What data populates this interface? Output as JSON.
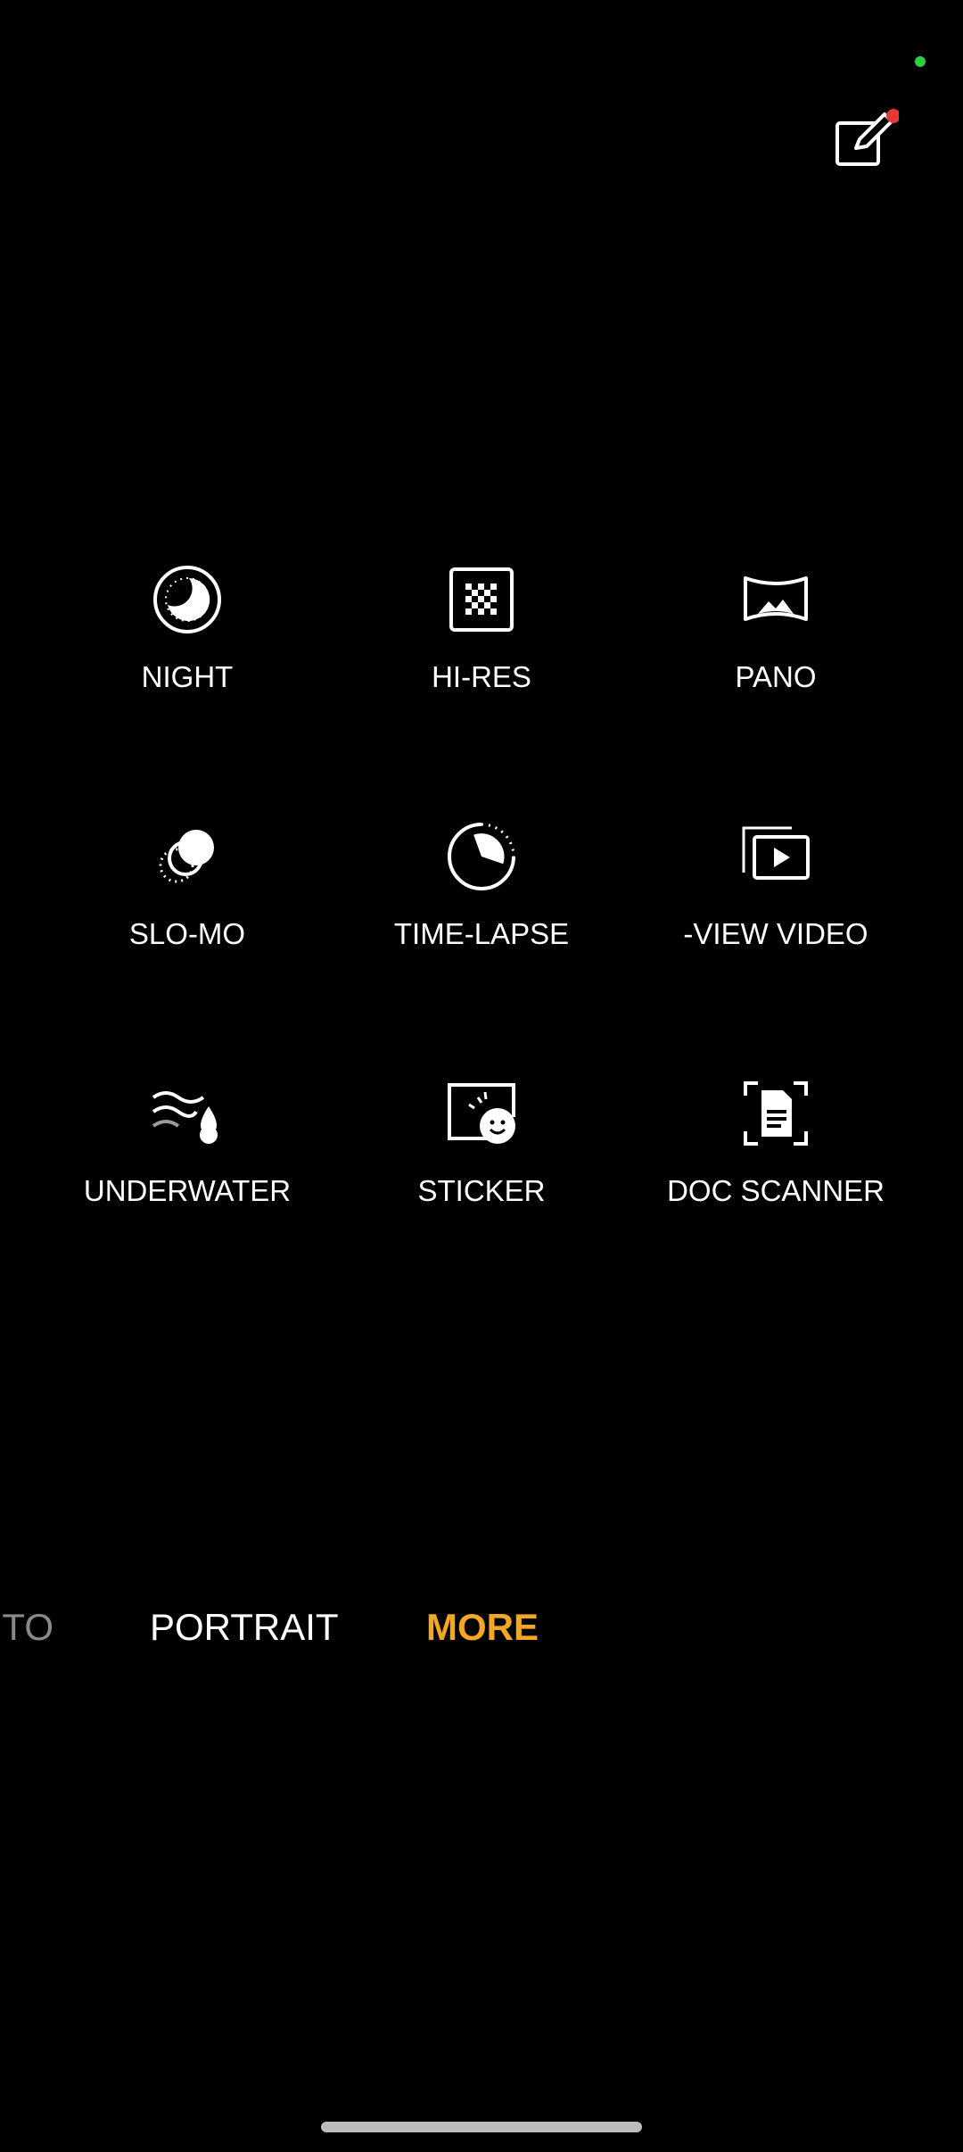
{
  "status": {
    "indicator_color": "#2ecc40"
  },
  "toolbar": {
    "edit_icon": "edit-icon",
    "badge_color": "#e53935"
  },
  "modes": [
    {
      "label": "NIGHT",
      "icon": "night-icon"
    },
    {
      "label": "HI-RES",
      "icon": "hires-icon"
    },
    {
      "label": "PANO",
      "icon": "pano-icon"
    },
    {
      "label": "SLO-MO",
      "icon": "slomo-icon"
    },
    {
      "label": "TIME-LAPSE",
      "icon": "timelapse-icon"
    },
    {
      "label": "-VIEW VIDEO",
      "icon": "dual-view-video-icon"
    },
    {
      "label": "UNDERWATER",
      "icon": "underwater-icon"
    },
    {
      "label": "STICKER",
      "icon": "sticker-icon"
    },
    {
      "label": "DOC SCANNER",
      "icon": "doc-scanner-icon"
    }
  ],
  "mode_bar": {
    "items": [
      "TO",
      "PORTRAIT",
      "MORE"
    ],
    "active": "MORE",
    "active_color": "#f5a623"
  }
}
